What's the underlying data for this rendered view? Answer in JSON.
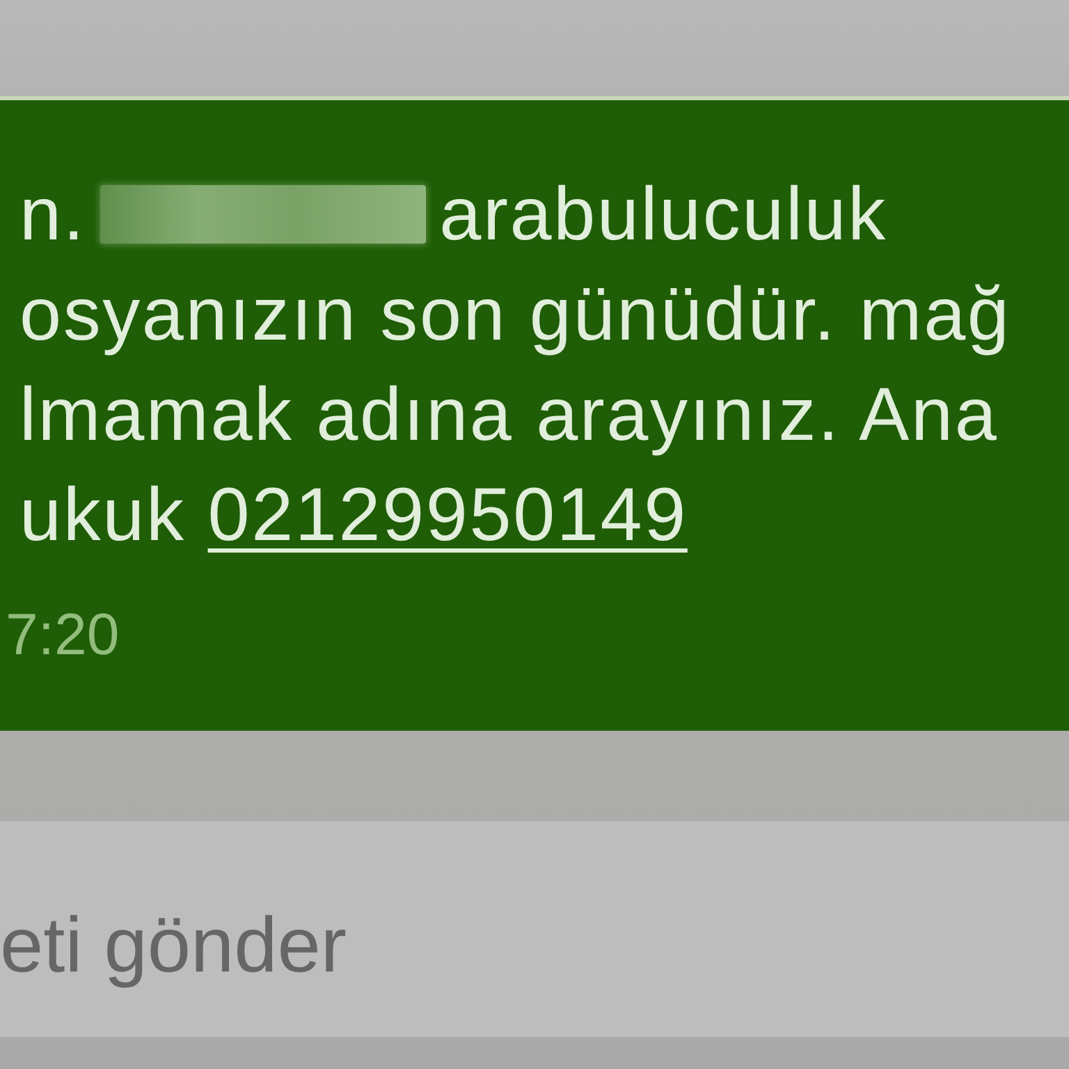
{
  "message": {
    "lines": [
      [
        {
          "kind": "text",
          "text": "n."
        },
        {
          "kind": "redacted"
        },
        {
          "kind": "text",
          "text": "arabuluculuk"
        }
      ],
      [
        {
          "kind": "text",
          "text": "osyanızın son günüdür. mağ"
        }
      ],
      [
        {
          "kind": "text",
          "text": "lmamak adına arayınız. Ana"
        }
      ],
      [
        {
          "kind": "text",
          "text": "ukuk"
        },
        {
          "kind": "link",
          "text": "02129950149"
        }
      ]
    ],
    "time": "7:20"
  },
  "compose": {
    "placeholder": "eti gönder"
  }
}
